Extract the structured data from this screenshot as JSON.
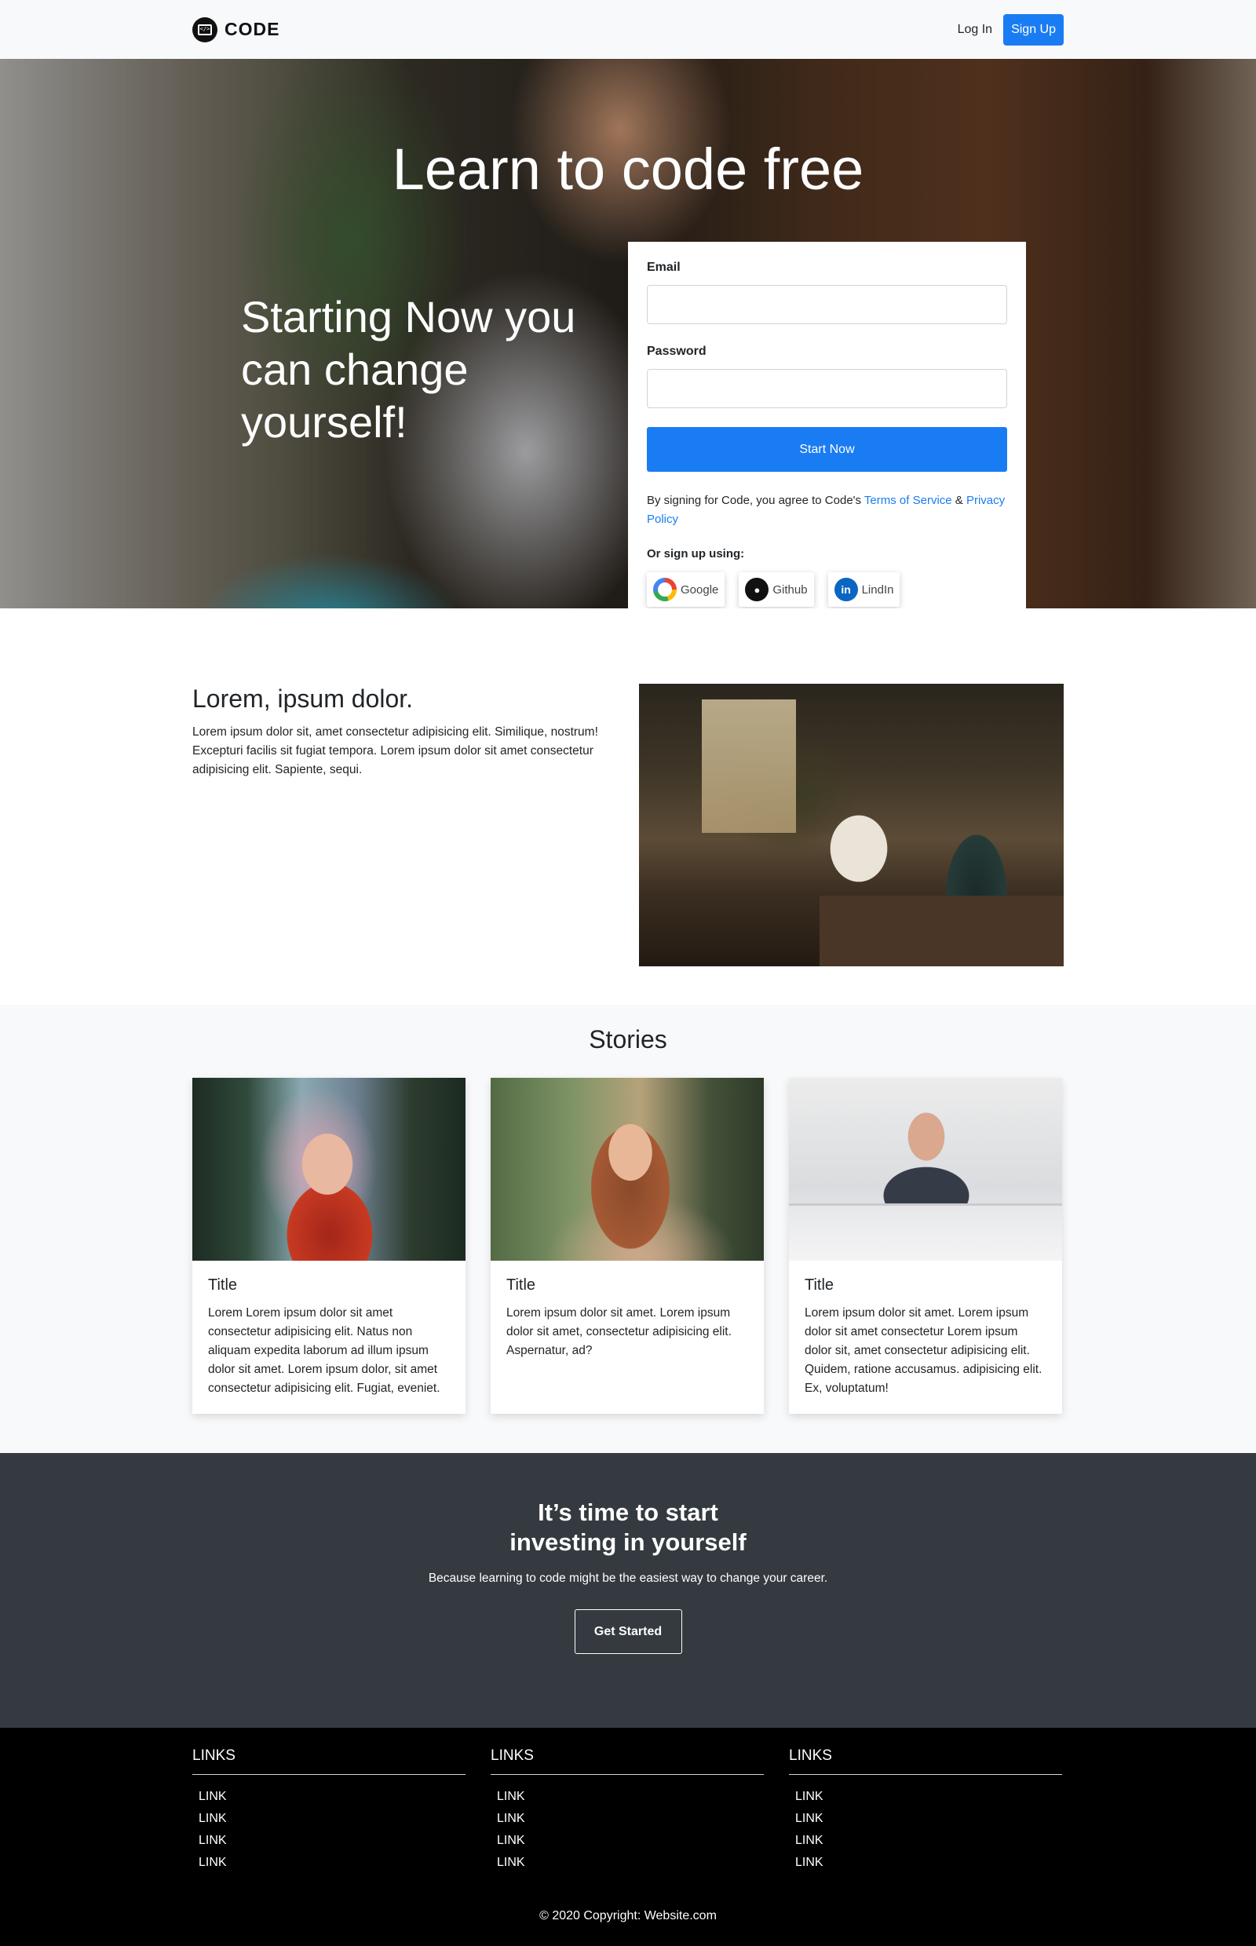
{
  "nav": {
    "brand": "CODE",
    "login": "Log In",
    "signup": "Sign Up"
  },
  "hero": {
    "title": "Learn to code free",
    "subtitle": "Starting Now you can change yourself!",
    "form": {
      "email_label": "Email",
      "password_label": "Password",
      "submit": "Start Now",
      "terms_prefix": "By signing for Code, you agree to Code's ",
      "terms_link": "Terms of Service",
      "terms_amp": " & ",
      "privacy_link": "Privacy Policy",
      "or_label": "Or sign up using:",
      "social": [
        "Google",
        "Github",
        "LindIn"
      ]
    }
  },
  "about": {
    "heading": "Lorem, ipsum dolor.",
    "body": "Lorem ipsum dolor sit, amet consectetur adipisicing elit. Similique, nostrum! Excepturi facilis sit fugiat tempora. Lorem ipsum dolor sit amet consectetur adipisicing elit. Sapiente, sequi."
  },
  "stories": {
    "title": "Stories",
    "cards": [
      {
        "title": "Title",
        "text": "Lorem Lorem ipsum dolor sit amet consectetur adipisicing elit. Natus non aliquam expedita laborum ad illum ipsum dolor sit amet. Lorem ipsum dolor, sit amet consectetur adipisicing elit. Fugiat, eveniet."
      },
      {
        "title": "Title",
        "text": "Lorem ipsum dolor sit amet. Lorem ipsum dolor sit amet, consectetur adipisicing elit. Aspernatur, ad?"
      },
      {
        "title": "Title",
        "text": "Lorem ipsum dolor sit amet. Lorem ipsum dolor sit amet consectetur Lorem ipsum dolor sit, amet consectetur adipisicing elit. Quidem, ratione accusamus. adipisicing elit. Ex, voluptatum!"
      }
    ]
  },
  "cta": {
    "title_line1": "It’s time to start",
    "title_line2": "investing in yourself",
    "subtitle": "Because learning to code might be the easiest way to change your career.",
    "button": "Get Started"
  },
  "footer": {
    "columns": [
      {
        "title": "LINKS",
        "links": [
          "LINK",
          "LINK",
          "LINK",
          "LINK"
        ]
      },
      {
        "title": "LINKS",
        "links": [
          "LINK",
          "LINK",
          "LINK",
          "LINK"
        ]
      },
      {
        "title": "LINKS",
        "links": [
          "LINK",
          "LINK",
          "LINK",
          "LINK"
        ]
      }
    ],
    "copyright": "© 2020 Copyright: Website.com"
  },
  "colors": {
    "accent": "#1a7cf2",
    "cta_bg": "#343a40",
    "footer_bg": "#000000"
  },
  "icons": {
    "brand": "code-screen-icon",
    "google": "google-icon",
    "github": "github-icon",
    "linkedin": "linkedin-icon"
  }
}
